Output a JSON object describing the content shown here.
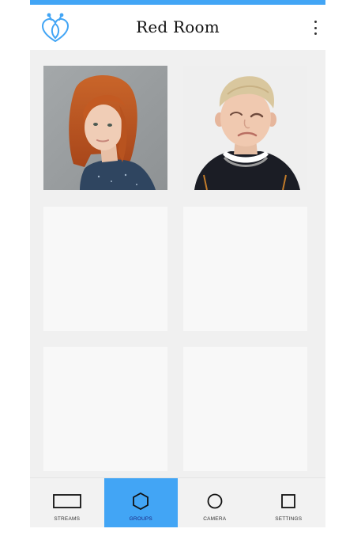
{
  "header": {
    "title": "Red Room",
    "logo_icon": "bee-heart-icon",
    "menu_icon": "more-vertical-icon",
    "accent_color": "#42a5f5"
  },
  "grid": {
    "tiles": [
      {
        "kind": "photo",
        "subject": "red-haired girl"
      },
      {
        "kind": "photo",
        "subject": "blond boy squinting"
      },
      {
        "kind": "empty"
      },
      {
        "kind": "empty"
      },
      {
        "kind": "empty"
      },
      {
        "kind": "empty"
      }
    ]
  },
  "bottom_nav": {
    "items": [
      {
        "label": "STREAMS",
        "icon": "rectangle-icon",
        "active": false
      },
      {
        "label": "GROUPS",
        "icon": "hexagon-icon",
        "active": true
      },
      {
        "label": "CAMERA",
        "icon": "circle-icon",
        "active": false
      },
      {
        "label": "SETTINGS",
        "icon": "square-icon",
        "active": false
      }
    ],
    "active_color": "#42a5f5"
  }
}
